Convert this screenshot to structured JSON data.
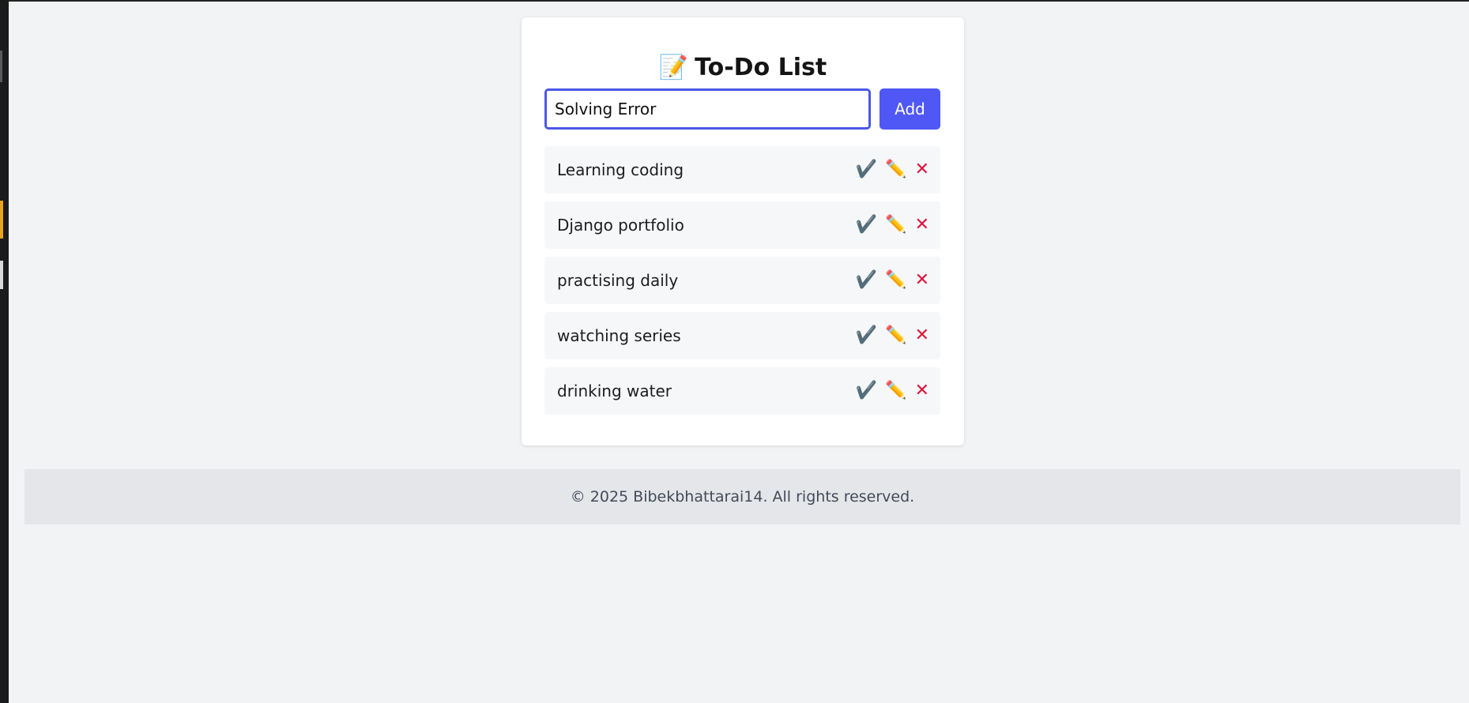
{
  "app": {
    "title": "To-Do List",
    "title_icon": "📝"
  },
  "form": {
    "input_value": "Solving Error",
    "add_label": "Add"
  },
  "icons": {
    "done": "✔️",
    "edit": "✏️",
    "delete": "✕"
  },
  "tasks": [
    {
      "label": "Learning coding"
    },
    {
      "label": "Django portfolio"
    },
    {
      "label": "practising daily"
    },
    {
      "label": "watching series"
    },
    {
      "label": "drinking water"
    }
  ],
  "footer": {
    "text": "© 2025 Bibekbhattarai14. All rights reserved."
  },
  "colors": {
    "accent": "#4f57f5",
    "delete": "#e0143c",
    "background": "#f2f3f5"
  }
}
